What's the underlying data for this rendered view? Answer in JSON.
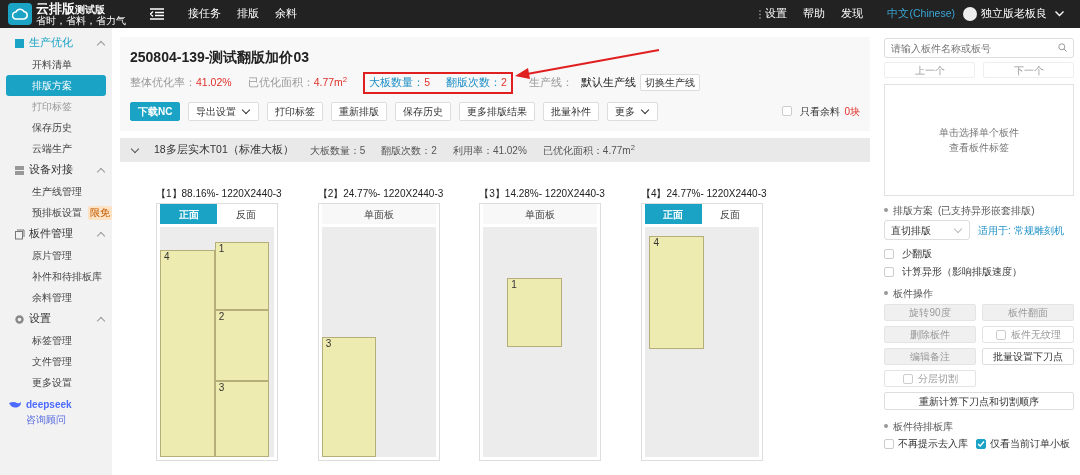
{
  "top_bar": {
    "logo": {
      "title": "云排版",
      "badge": "测试版",
      "slogan": "省时，省料，省力气"
    },
    "nav": [
      "接任务",
      "排版",
      "余料"
    ],
    "links": [
      "设置",
      "帮助",
      "发现"
    ],
    "language": "中文(Chinese)",
    "user": "独立版老板良"
  },
  "sidebar": {
    "groups": [
      {
        "label": "生产优化",
        "expanded": true,
        "items": [
          {
            "label": "开料清单",
            "selected": false,
            "disabled": false
          },
          {
            "label": "排版方案",
            "selected": true,
            "disabled": false
          },
          {
            "label": "打印标签",
            "selected": false,
            "disabled": true
          },
          {
            "label": "保存历史",
            "selected": false,
            "disabled": false
          },
          {
            "label": "云端生产",
            "selected": false,
            "disabled": false
          }
        ]
      },
      {
        "label": "设备对接",
        "expanded": true,
        "items": [
          {
            "label": "生产线管理",
            "selected": false,
            "disabled": false
          },
          {
            "label": "预排板设置",
            "selected": false,
            "disabled": false,
            "badge": "限免"
          }
        ]
      },
      {
        "label": "板件管理",
        "expanded": true,
        "items": [
          {
            "label": "原片管理",
            "selected": false,
            "disabled": false
          },
          {
            "label": "补件和待排板库",
            "selected": false,
            "disabled": false
          },
          {
            "label": "余料管理",
            "selected": false,
            "disabled": false
          }
        ]
      },
      {
        "label": "设置",
        "expanded": true,
        "items": [
          {
            "label": "标签管理",
            "selected": false,
            "disabled": false
          },
          {
            "label": "文件管理",
            "selected": false,
            "disabled": false
          },
          {
            "label": "更多设置",
            "selected": false,
            "disabled": false
          }
        ]
      }
    ],
    "assistant": {
      "brand": "deepseek",
      "label": "咨询顾问"
    }
  },
  "header": {
    "title": "250804-139-测试翻版加价03",
    "stats": [
      {
        "label": "整体优化率：",
        "value": "41.02%",
        "highlighted": false
      },
      {
        "label": "已优化面积：",
        "value": "4.77m$^{2}$",
        "highlighted": false
      },
      {
        "label": "大板数量：",
        "value": "5",
        "highlighted": true
      },
      {
        "label": "翻版次数：",
        "value": "2",
        "highlighted": true
      }
    ],
    "line": {
      "label": "生产线：",
      "value": "默认生产线",
      "button": "切换生产线"
    },
    "buttons": [
      {
        "label": "下载NC",
        "kind": "primary",
        "dropdown": false
      },
      {
        "label": "导出设置",
        "kind": "default",
        "dropdown": true
      },
      {
        "label": "打印标签",
        "kind": "default",
        "dropdown": false
      },
      {
        "label": "重新排版",
        "kind": "default",
        "dropdown": false
      },
      {
        "label": "保存历史",
        "kind": "default",
        "dropdown": false
      },
      {
        "label": "更多排版结果",
        "kind": "default",
        "dropdown": false
      },
      {
        "label": "批量补件",
        "kind": "default",
        "dropdown": false
      },
      {
        "label": "更多",
        "kind": "default",
        "dropdown": true
      }
    ],
    "only_remnant": {
      "label": "只看余料",
      "checked": false,
      "count": "0块"
    }
  },
  "group": {
    "title": "18多层实木T01（标准大板）",
    "expanded": true,
    "stats": [
      "大板数量：5",
      "翻版次数：2",
      "利用率：41.02%",
      "已优化面积：4.77m$^{2}$"
    ]
  },
  "boards": [
    {
      "title": "【1】88.16%- 1220X2440-3",
      "tabs": [
        {
          "label": "正面",
          "selected": true
        },
        {
          "label": "反面",
          "selected": false
        }
      ],
      "pieces": [
        {
          "label": "4"
        },
        {
          "label": "1"
        },
        {
          "label": "2"
        },
        {
          "label": "3"
        }
      ]
    },
    {
      "title": "【2】24.77%- 1220X2440-3",
      "single": "单面板",
      "pieces": [
        {
          "label": "3"
        }
      ]
    },
    {
      "title": "【3】14.28%- 1220X2440-3",
      "single": "单面板",
      "pieces": [
        {
          "label": "1"
        }
      ]
    },
    {
      "title": "【4】24.77%- 1220X2440-3",
      "tabs": [
        {
          "label": "正面",
          "selected": true
        },
        {
          "label": "反面",
          "selected": false
        }
      ],
      "pieces": [
        {
          "label": "4"
        }
      ]
    }
  ],
  "right_panel": {
    "search": {
      "placeholder": "请输入板件名称或板号"
    },
    "nav_buttons": [
      "上一个",
      "下一个"
    ],
    "preview_text": [
      "单击选择单个板件",
      "查看板件标签"
    ],
    "scheme": {
      "title": "排版方案",
      "note": "(已支持异形嵌套排版)",
      "select": "直切排版",
      "link": "适用于: 常规雕刻机",
      "options": [
        {
          "label": "少翻版",
          "checked": false
        },
        {
          "label": "计算异形（影响排版速度）",
          "checked": false
        }
      ]
    },
    "operations": {
      "title": "板件操作",
      "items": [
        {
          "label": "旋转90度",
          "kind": "button",
          "disabled": true
        },
        {
          "label": "板件翻面",
          "kind": "button",
          "disabled": true
        },
        {
          "label": "删除板件",
          "kind": "button",
          "disabled": true
        },
        {
          "label": "板件无纹理",
          "kind": "checkbox",
          "disabled": true,
          "checked": false
        },
        {
          "label": "编辑备注",
          "kind": "button",
          "disabled": true
        },
        {
          "label": "批量设置下刀点",
          "kind": "button",
          "disabled": false
        },
        {
          "label": "分层切割",
          "kind": "checkbox",
          "disabled": true,
          "checked": false
        }
      ],
      "wide_button": "重新计算下刀点和切割顺序"
    },
    "library": {
      "title": "板件待排板库",
      "options": [
        {
          "label": "不再提示去入库",
          "checked": false
        },
        {
          "label": "仅看当前订单小板",
          "checked": true
        }
      ]
    }
  }
}
